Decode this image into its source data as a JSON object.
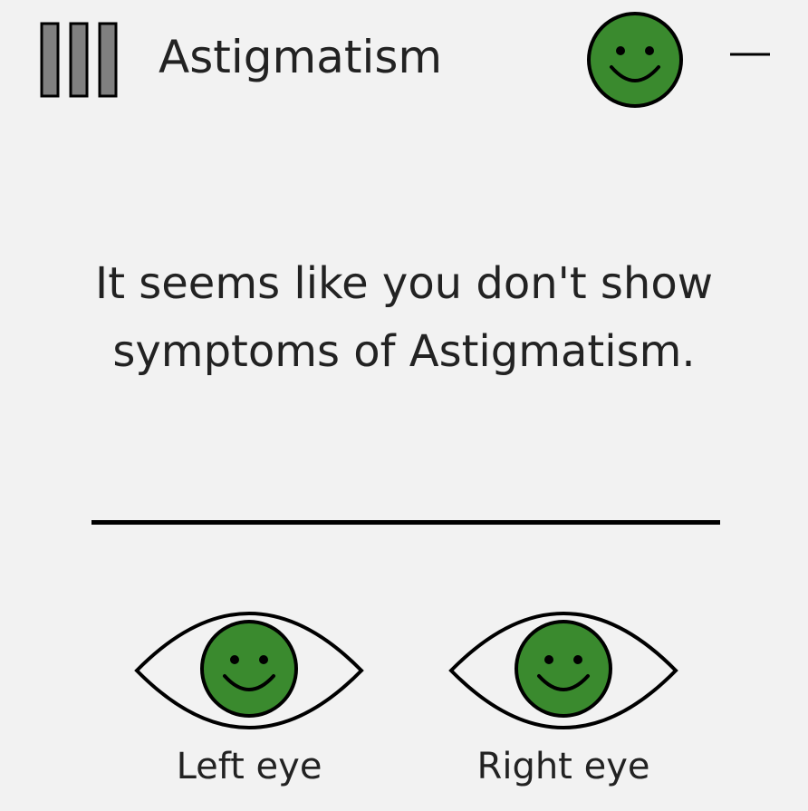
{
  "header": {
    "title": "Astigmatism",
    "menu_icon": "menu-bars-icon",
    "status_icon": "smiley-face-icon",
    "minimize_icon": "minimize-icon"
  },
  "result": {
    "message": "It seems like you don't show symptoms of Astigmatism."
  },
  "eyes": [
    {
      "label": "Left eye",
      "icon": "smiley-face-icon"
    },
    {
      "label": "Right eye",
      "icon": "smiley-face-icon"
    }
  ],
  "colors": {
    "background": "#f2f2f2",
    "smiley_green": "#3a8a2e",
    "menu_gray": "#808080",
    "text": "#222222"
  }
}
